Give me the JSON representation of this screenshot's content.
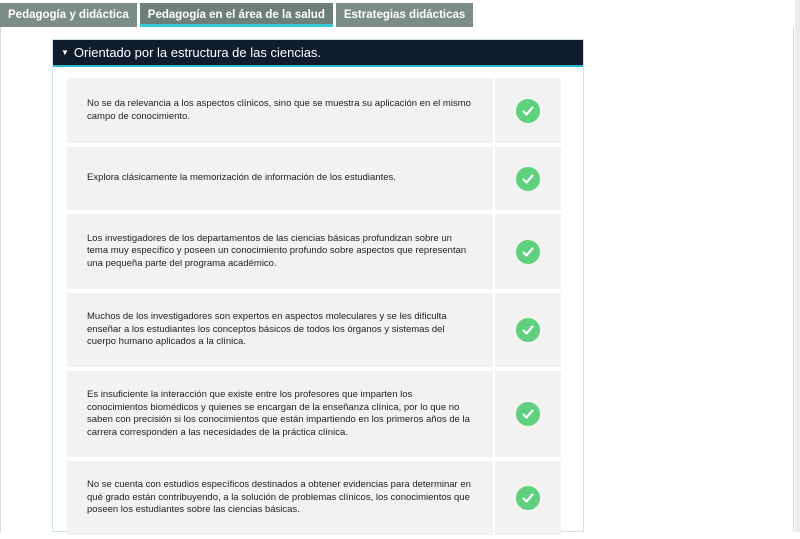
{
  "tabs": [
    {
      "label": "Pedagogía y didáctica"
    },
    {
      "label": "Pedagogía en el área de la salud"
    },
    {
      "label": "Estrategias didácticas"
    }
  ],
  "accordion": {
    "title": "Orientado por la estructura de las ciencias.",
    "items": [
      {
        "text": "No se da relevancia a los aspectos clínicos, sino que se muestra su aplicación en el mismo campo de conocimiento.",
        "checked": true
      },
      {
        "text": "Explora clásicamente la memorización de información de los estudiantes.",
        "checked": true
      },
      {
        "text": "Los investigadores de los departamentos de las ciencias básicas profundizan sobre un tema muy específico y poseen un conocimiento profundo sobre aspectos que representan una pequeña parte del programa académico.",
        "checked": true
      },
      {
        "text": "Muchos de los investigadores son expertos en aspectos moleculares y se les dificulta enseñar a los estudiantes los conceptos básicos de todos los órganos y sistemas del cuerpo humano aplicados a la clínica.",
        "checked": true
      },
      {
        "text": "Es insuficiente la interacción que existe entre los profesores que imparten los conocimientos biomédicos y quienes se encargan de la enseñanza clínica, por lo que no saben con precisión si los conocimientos que están impartiendo en los primeros años de la carrera corresponden a las necesidades de la práctica clínica.",
        "checked": true
      },
      {
        "text": "No se cuenta con estudios específicos destinados a obtener evidencias para determinar en qué grado están contribuyendo, a la solución de problemas clínicos, los conocimientos que poseen los estudiantes sobre las ciencias básicas.",
        "checked": true
      }
    ]
  },
  "colors": {
    "header_bg": "#101b2b",
    "accent": "#2bb6d0",
    "check": "#5fd07e",
    "tab_bg": "#7c8c88"
  },
  "icons": {
    "caret": "caret-down-icon",
    "check": "check-circle-icon"
  }
}
